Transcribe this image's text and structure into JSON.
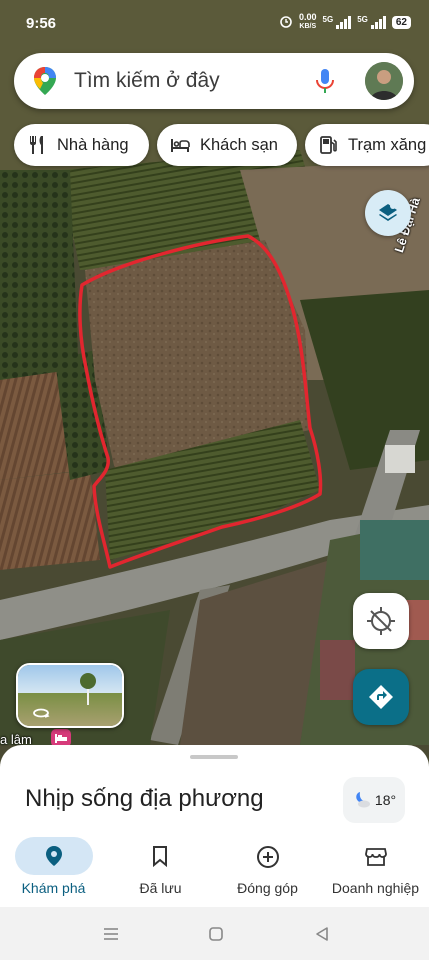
{
  "status_bar": {
    "time": "9:56",
    "net_speed_value": "0.00",
    "net_speed_unit": "KB/S",
    "network_1": "5G",
    "network_2": "5G",
    "battery": "62"
  },
  "search": {
    "placeholder": "Tìm kiếm ở đây",
    "icons": [
      "maps-pin-icon",
      "microphone-icon",
      "avatar"
    ]
  },
  "chips": [
    {
      "label": "Nhà hàng",
      "icon": "restaurant-icon"
    },
    {
      "label": "Khách sạn",
      "icon": "hotel-bed-icon"
    },
    {
      "label": "Trạm xăng",
      "icon": "gas-station-icon"
    }
  ],
  "map": {
    "street_label": "Lê Đại Hà",
    "place_label": "a lâm",
    "annotation_color": "#e2262f"
  },
  "sheet": {
    "title": "Nhịp sống địa phương",
    "weather_temp": "18°"
  },
  "bottom_nav": [
    {
      "label": "Khám phá",
      "icon": "explore-pin-icon",
      "active": true
    },
    {
      "label": "Đã lưu",
      "icon": "bookmark-icon",
      "active": false
    },
    {
      "label": "Đóng góp",
      "icon": "add-circle-icon",
      "active": false
    },
    {
      "label": "Doanh nghiệp",
      "icon": "storefront-icon",
      "active": false
    }
  ],
  "colors": {
    "active_nav_bg": "#d4e6f5",
    "active_nav_text": "#0b5f80",
    "directions_button": "#0b6f88",
    "layers_button": "#d8ecf6"
  }
}
